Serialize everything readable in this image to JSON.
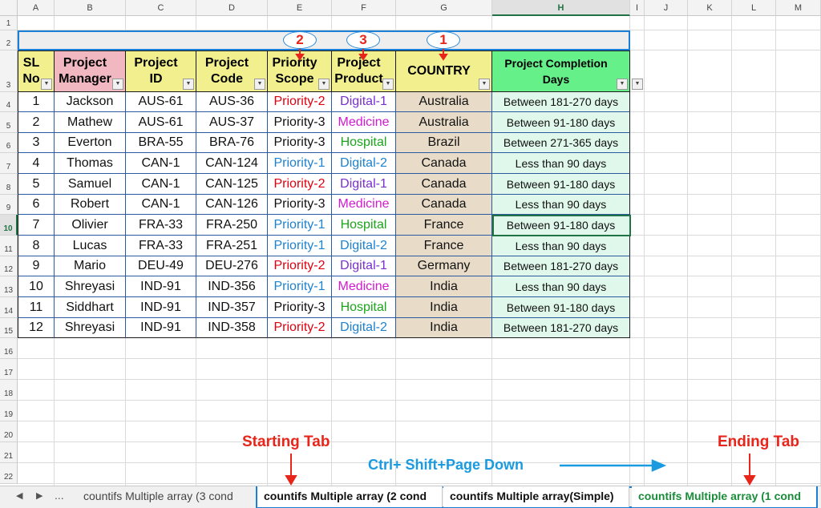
{
  "columns": [
    "A",
    "B",
    "C",
    "D",
    "E",
    "F",
    "G",
    "H",
    "I",
    "J",
    "K",
    "L",
    "M"
  ],
  "rows": [
    "1",
    "2",
    "3",
    "4",
    "5",
    "6",
    "7",
    "8",
    "9",
    "10",
    "11",
    "12",
    "13",
    "14",
    "15",
    "16",
    "17",
    "18",
    "19",
    "20",
    "21",
    "22"
  ],
  "headers": {
    "sl": "SL No",
    "manager": "Project Manager",
    "project_id": "Project ID",
    "project_code": "Project Code",
    "priority": "Priority Scope",
    "product": "Project Product",
    "country": "COUNTRY",
    "completion": "Project Completion Days"
  },
  "records": [
    [
      "1",
      "Jackson",
      "AUS-61",
      "AUS-36",
      "Priority-2",
      "Digital-1",
      "Australia",
      "Between 181-270 days"
    ],
    [
      "2",
      "Mathew",
      "AUS-61",
      "AUS-37",
      "Priority-3",
      "Medicine",
      "Australia",
      "Between 91-180 days"
    ],
    [
      "3",
      "Everton",
      "BRA-55",
      "BRA-76",
      "Priority-3",
      "Hospital",
      "Brazil",
      "Between 271-365 days"
    ],
    [
      "4",
      "Thomas",
      "CAN-1",
      "CAN-124",
      "Priority-1",
      "Digital-2",
      "Canada",
      "Less than 90 days"
    ],
    [
      "5",
      "Samuel",
      "CAN-1",
      "CAN-125",
      "Priority-2",
      "Digital-1",
      "Canada",
      "Between 91-180 days"
    ],
    [
      "6",
      "Robert",
      "CAN-1",
      "CAN-126",
      "Priority-3",
      "Medicine",
      "Canada",
      "Less than 90 days"
    ],
    [
      "7",
      "Olivier",
      "FRA-33",
      "FRA-250",
      "Priority-1",
      "Hospital",
      "France",
      "Between 91-180 days"
    ],
    [
      "8",
      "Lucas",
      "FRA-33",
      "FRA-251",
      "Priority-1",
      "Digital-2",
      "France",
      "Less than 90 days"
    ],
    [
      "9",
      "Mario",
      "DEU-49",
      "DEU-276",
      "Priority-2",
      "Digital-1",
      "Germany",
      "Between 181-270 days"
    ],
    [
      "10",
      "Shreyasi",
      "IND-91",
      "IND-356",
      "Priority-1",
      "Medicine",
      "India",
      "Less than 90 days"
    ],
    [
      "11",
      "Siddhart",
      "IND-91",
      "IND-357",
      "Priority-3",
      "Hospital",
      "India",
      "Between 91-180 days"
    ],
    [
      "12",
      "Shreyasi",
      "IND-91",
      "IND-358",
      "Priority-2",
      "Digital-2",
      "India",
      "Between 181-270 days"
    ]
  ],
  "annotations": {
    "badge_priority": "2",
    "badge_product": "3",
    "badge_country": "1",
    "starting_tab": "Starting Tab",
    "ending_tab": "Ending Tab",
    "shortcut": "Ctrl+ Shift+Page Down"
  },
  "tabs": {
    "nav_more": "...",
    "tab_3": "countifs Multiple array (3 cond",
    "tab_2": "countifs Multiple array (2 cond",
    "tab_simple": "countifs Multiple array(Simple)",
    "tab_1": "countifs Multiple array (1 cond"
  },
  "colors": {
    "header_yellow": "#f2f08e",
    "header_pink": "#f2b8c2",
    "header_green": "#66f08a",
    "country_fill": "#e8dcc8",
    "completion_fill": "#e0f8ec",
    "selection_green": "#217346"
  }
}
